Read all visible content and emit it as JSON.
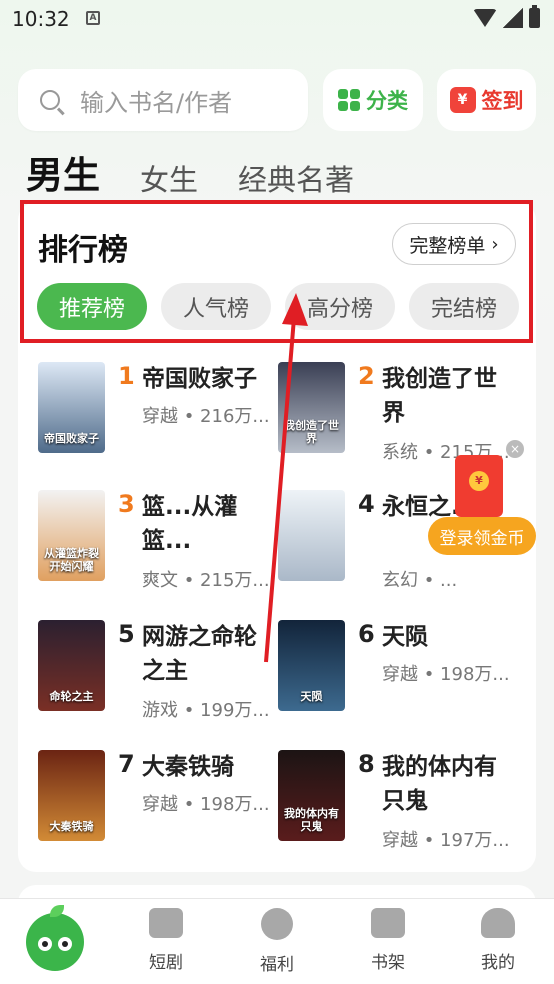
{
  "status_bar": {
    "time": "10:32",
    "notif_glyph": "A"
  },
  "search": {
    "placeholder": "输入书名/作者",
    "icon": "search-icon"
  },
  "header_buttons": {
    "category_label": "分类",
    "signin_label": "签到",
    "signin_glyph": "¥"
  },
  "gender_tabs": [
    {
      "label": "男生",
      "active": true
    },
    {
      "label": "女生",
      "active": false
    },
    {
      "label": "经典名著",
      "active": false
    }
  ],
  "ranking": {
    "title": "排行榜",
    "full_list_label": "完整榜单",
    "tabs": [
      {
        "label": "推荐榜",
        "active": true
      },
      {
        "label": "人气榜",
        "active": false
      },
      {
        "label": "高分榜",
        "active": false
      },
      {
        "label": "完结榜",
        "active": false
      }
    ]
  },
  "books": [
    {
      "rank": "1",
      "title": "帝国败家子",
      "meta": "穿越 • 216万...",
      "rank_color": "#f07a1e",
      "cover_top": "#dde8f5",
      "cover_bottom": "#4f6b8a",
      "cover_text": "帝国败家子"
    },
    {
      "rank": "2",
      "title": "我创造了世界",
      "meta": "系统 • 215万...",
      "rank_color": "#f07a1e",
      "cover_top": "#3a3f54",
      "cover_bottom": "#b6bdc8",
      "cover_text": "我创造了世界"
    },
    {
      "rank": "3",
      "title": "篮...从灌篮...",
      "meta": "爽文 • 215万...",
      "rank_color": "#f07a1e",
      "cover_top": "#f2f2f2",
      "cover_bottom": "#e0a060",
      "cover_text": "从灌篮炸裂开始闪耀"
    },
    {
      "rank": "4",
      "title": "永恒之...",
      "meta": "玄幻 • ...",
      "rank_color": "#222222",
      "cover_top": "#eef3f7",
      "cover_bottom": "#aab8c8",
      "cover_text": ""
    },
    {
      "rank": "5",
      "title": "网游之命轮之主",
      "meta": "游戏 • 199万...",
      "rank_color": "#222222",
      "cover_top": "#2b2030",
      "cover_bottom": "#7a2f25",
      "cover_text": "命轮之主"
    },
    {
      "rank": "6",
      "title": "天陨",
      "meta": "穿越 • 198万...",
      "rank_color": "#222222",
      "cover_top": "#12243a",
      "cover_bottom": "#3d6a8f",
      "cover_text": "天陨"
    },
    {
      "rank": "7",
      "title": "大秦铁骑",
      "meta": "穿越 • 198万...",
      "rank_color": "#222222",
      "cover_top": "#6b2413",
      "cover_bottom": "#d28b36",
      "cover_text": "大秦铁骑"
    },
    {
      "rank": "8",
      "title": "我的体内有只鬼",
      "meta": "穿越 • 197万...",
      "rank_color": "#222222",
      "cover_top": "#1c1414",
      "cover_bottom": "#5a1c1c",
      "cover_text": "我的体内有只鬼"
    }
  ],
  "float_promo": {
    "button_label": "登录领金币",
    "close_glyph": "×",
    "coin_glyph": "¥"
  },
  "bottom_nav": [
    {
      "label": "",
      "icon": "mascot-icon"
    },
    {
      "label": "短剧",
      "icon": "tv-icon"
    },
    {
      "label": "福利",
      "icon": "gift-icon"
    },
    {
      "label": "书架",
      "icon": "bookshelf-icon"
    },
    {
      "label": "我的",
      "icon": "user-icon"
    }
  ],
  "colors": {
    "accent_green": "#4bb84f",
    "highlight_red": "#e01e24",
    "gold": "#f6a51f"
  }
}
